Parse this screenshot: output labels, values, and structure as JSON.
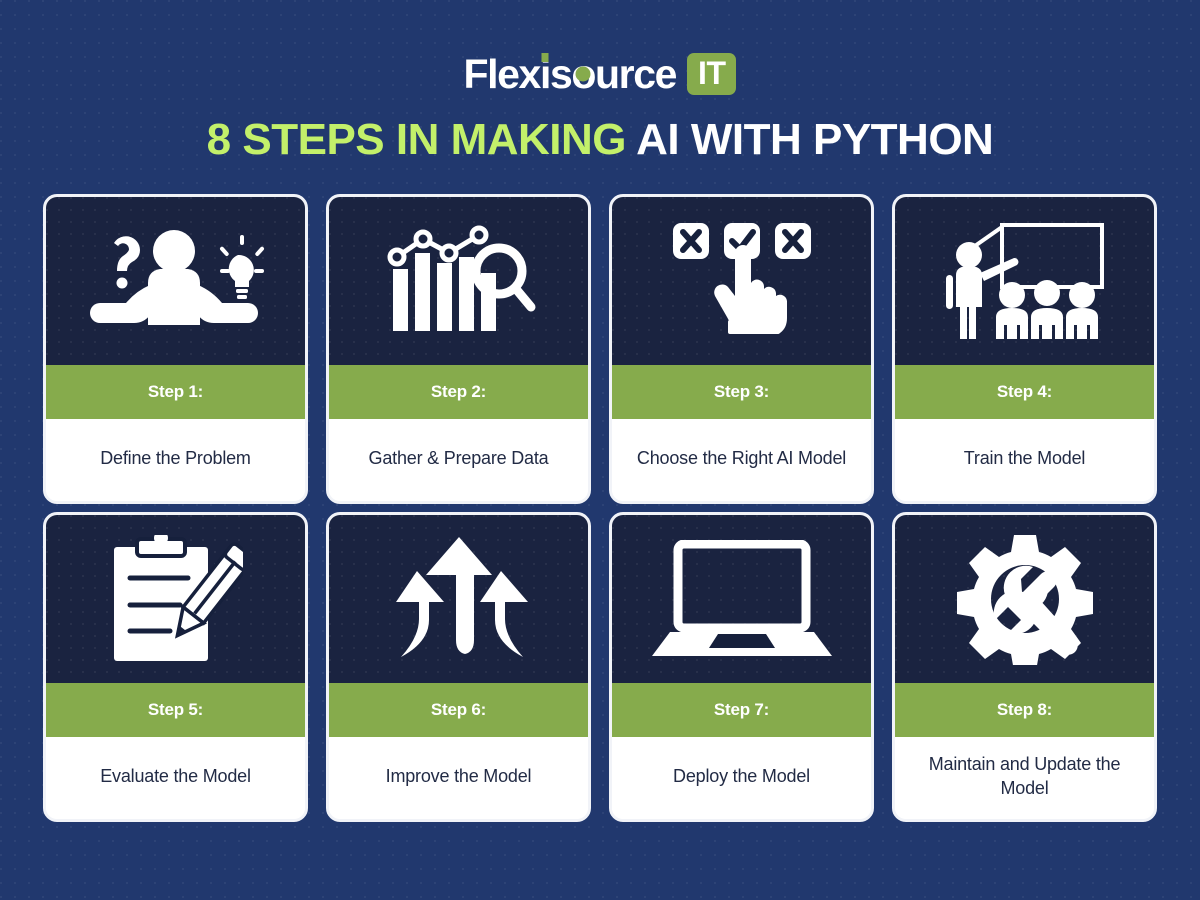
{
  "brand": {
    "name": "Flexisource IT",
    "word_part_1": "Flex",
    "word_part_i": "i",
    "word_part_s": "s",
    "word_part_o": "o",
    "word_part_end": "urce",
    "badge": "IT",
    "accent_color": "#86ab4c"
  },
  "header": {
    "title_accent": "8 STEPS IN MAKING",
    "title_plain": "AI WITH PYTHON",
    "title_full": "8 STEPS IN MAKING AI WITH PYTHON",
    "accent_color": "#c3f06a",
    "plain_color": "#ffffff"
  },
  "theme": {
    "background": "#21386e",
    "panel": "#1a2340",
    "band": "#86ab4c",
    "body_bg": "#ffffff",
    "body_text": "#222b45",
    "card_border": "#f1f3f8"
  },
  "steps": [
    {
      "label": "Step 1:",
      "title": "Define the Problem",
      "icon": "person-shrug-question-lightbulb-icon"
    },
    {
      "label": "Step 2:",
      "title": "Gather & Prepare Data",
      "icon": "bar-chart-line-magnifier-icon"
    },
    {
      "label": "Step 3:",
      "title": "Choose the Right AI Model",
      "title_line_1": "Choose the Right",
      "title_line_2": "AI Model",
      "icon": "hand-select-checkbox-icon"
    },
    {
      "label": "Step 4:",
      "title": "Train the Model",
      "icon": "teacher-whiteboard-students-icon"
    },
    {
      "label": "Step 5:",
      "title": "Evaluate the Model",
      "icon": "clipboard-pencil-icon"
    },
    {
      "label": "Step 6:",
      "title": "Improve the Model",
      "icon": "three-up-arrows-icon"
    },
    {
      "label": "Step 7:",
      "title": "Deploy the Model",
      "icon": "laptop-icon"
    },
    {
      "label": "Step 8:",
      "title": "Maintain and Update the Model",
      "title_line_1": "Maintain and Update",
      "title_line_2": "the Model",
      "icon": "gear-wrench-icon"
    }
  ]
}
